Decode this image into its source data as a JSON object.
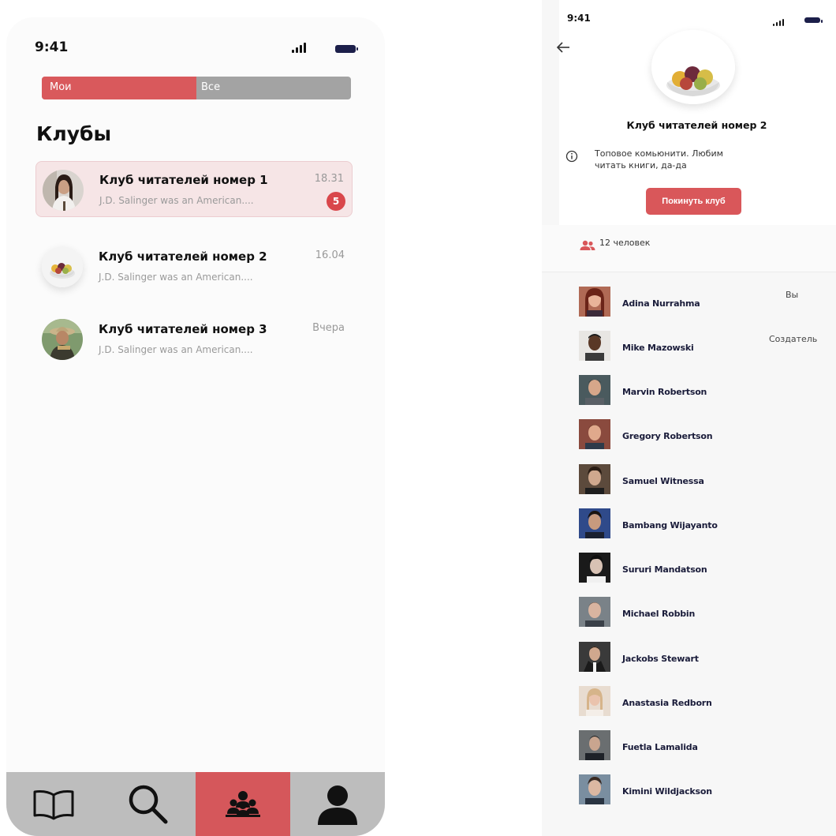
{
  "left": {
    "status": {
      "time": "9:41"
    },
    "segments": {
      "mine": "Мои",
      "all": "Все"
    },
    "title": "Клубы",
    "clubs": [
      {
        "name": "Клуб читателей номер 1",
        "preview": "J.D. Salinger was an American....",
        "time": "18.31",
        "badge": "5",
        "active": true
      },
      {
        "name": "Клуб читателей номер 2",
        "preview": "J.D. Salinger was an American....",
        "time": "16.04",
        "active": false
      },
      {
        "name": "Клуб читателей номер 3",
        "preview": "J.D. Salinger was an American....",
        "time": "Вчера",
        "active": false
      }
    ],
    "tabbar": [
      {
        "icon": "book-icon",
        "active": false
      },
      {
        "icon": "search-icon",
        "active": false
      },
      {
        "icon": "community-icon",
        "active": true
      },
      {
        "icon": "profile-icon",
        "active": false
      }
    ]
  },
  "right": {
    "status": {
      "time": "9:41"
    },
    "club_title": "Клуб читателей номер 2",
    "description_line1": "Топовое комьюнити. Любим",
    "description_line2": "читать книги, да-да",
    "leave_label": "Покинуть клуб",
    "members_count": "12 человек",
    "members": [
      {
        "name": "Adina Nurrahma",
        "role": "Вы"
      },
      {
        "name": "Mike Mazowski",
        "role": "Создатель"
      },
      {
        "name": "Marvin Robertson",
        "role": ""
      },
      {
        "name": "Gregory Robertson",
        "role": ""
      },
      {
        "name": "Samuel Witnessa",
        "role": ""
      },
      {
        "name": "Bambang Wijayanto",
        "role": ""
      },
      {
        "name": "Sururi Mandatson",
        "role": ""
      },
      {
        "name": "Michael Robbin",
        "role": ""
      },
      {
        "name": "Jackobs Stewart",
        "role": ""
      },
      {
        "name": "Anastasia Redborn",
        "role": ""
      },
      {
        "name": "Fuetla Lamalida",
        "role": ""
      },
      {
        "name": "Kimini Wildjackson",
        "role": ""
      }
    ]
  },
  "colors": {
    "accent": "#d9595c",
    "segment_inactive": "#a3a3a3",
    "tabbar_bg": "#bdbdbd",
    "active_row_bg": "#f6e5e6"
  }
}
